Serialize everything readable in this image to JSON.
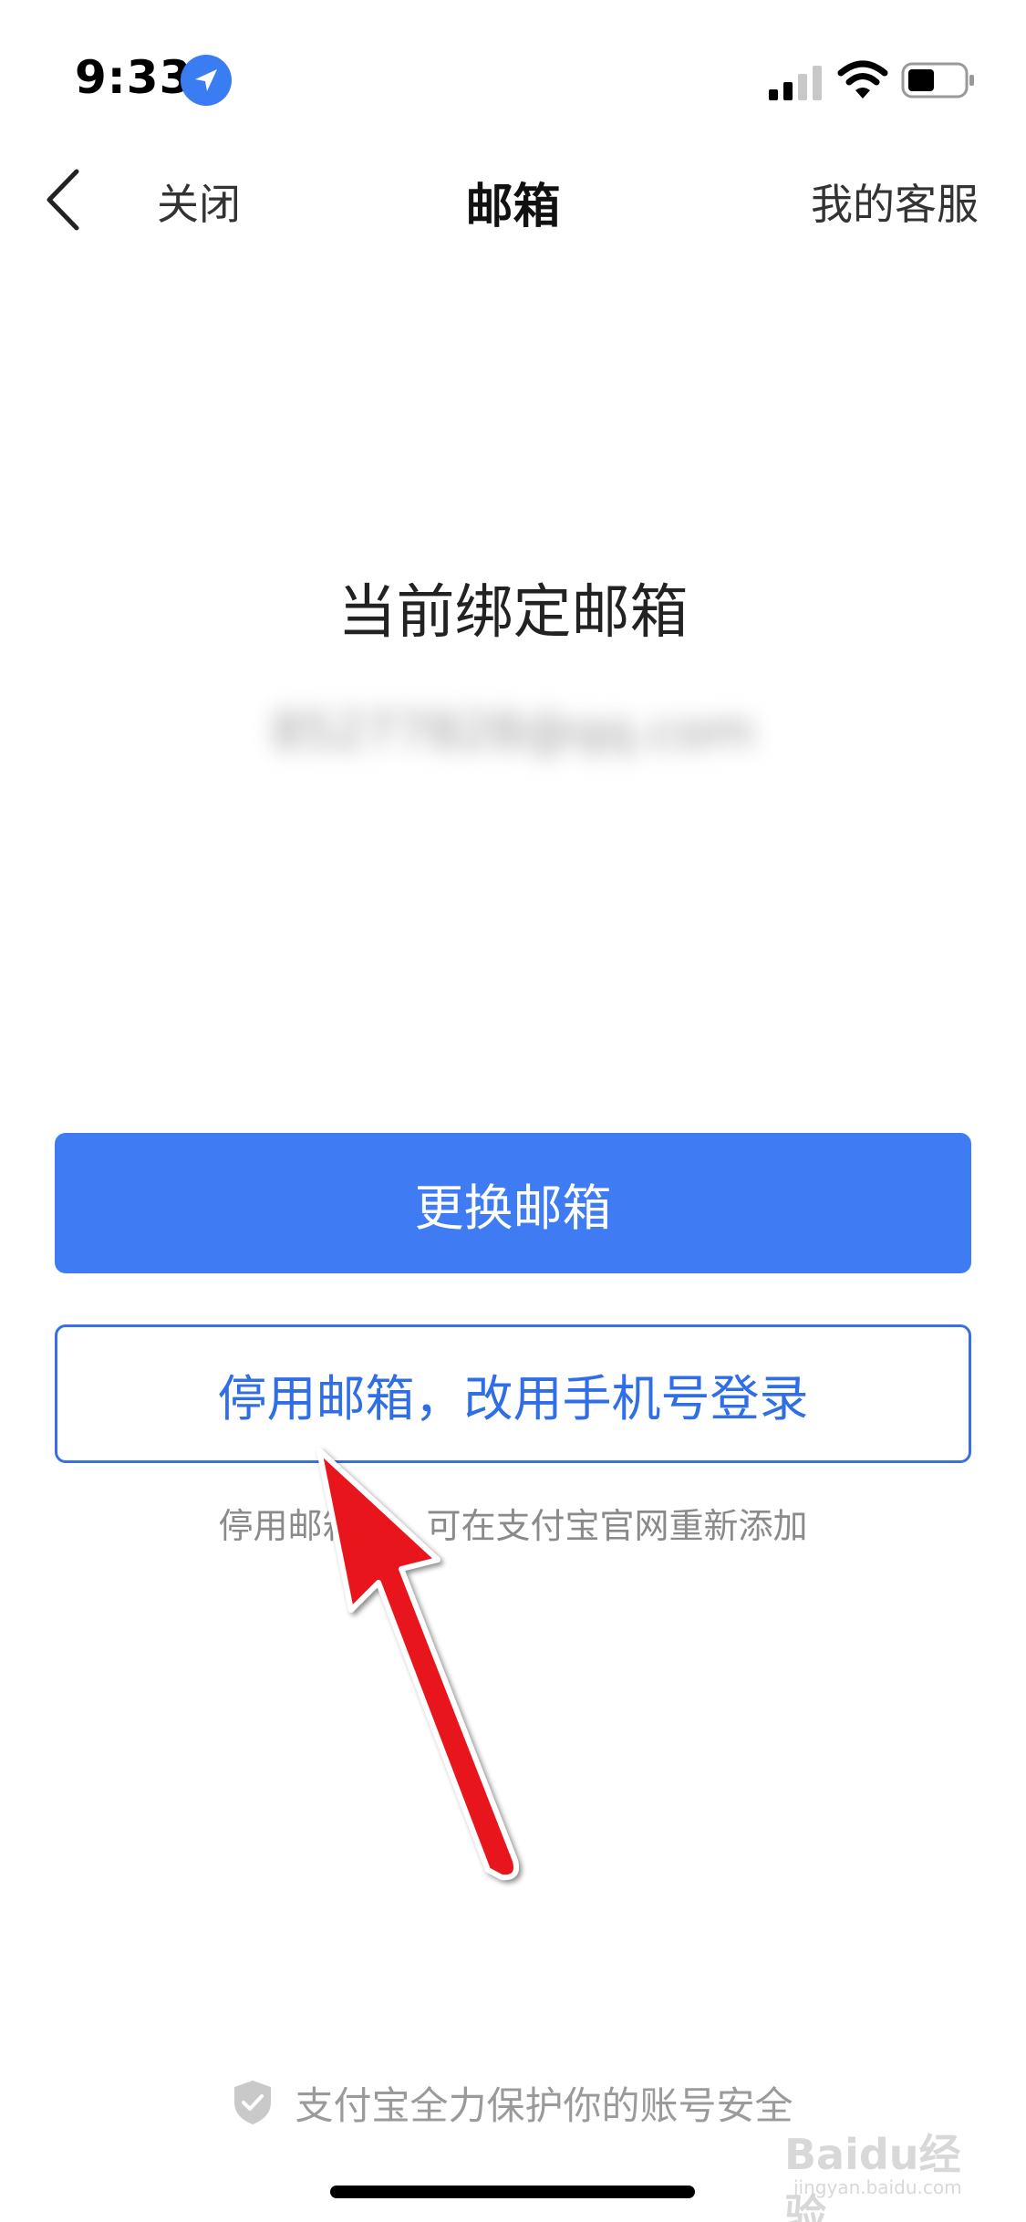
{
  "status_bar": {
    "time": "9:33",
    "icons": [
      "location-icon",
      "signal-icon",
      "wifi-icon",
      "battery-icon"
    ]
  },
  "nav": {
    "close_label": "关闭",
    "title": "邮箱",
    "service_label": "我的客服",
    "back_icon": "chevron-left-icon"
  },
  "main": {
    "heading": "当前绑定邮箱",
    "email_masked": "85277828@qq.com"
  },
  "actions": {
    "change_email_label": "更换邮箱",
    "disable_email_label": "停用邮箱，改用手机号登录",
    "hint": "停用邮箱后，可在支付宝官网重新添加"
  },
  "footer": {
    "security_text": "支付宝全力保护你的账号安全",
    "icon": "shield-check-icon"
  },
  "watermark": {
    "brand": "Baidu经验",
    "url": "jingyan.baidu.com"
  },
  "colors": {
    "primary": "#3f7cf4",
    "secondary_text": "#2f6ee6",
    "arrow": "#e8131b"
  }
}
